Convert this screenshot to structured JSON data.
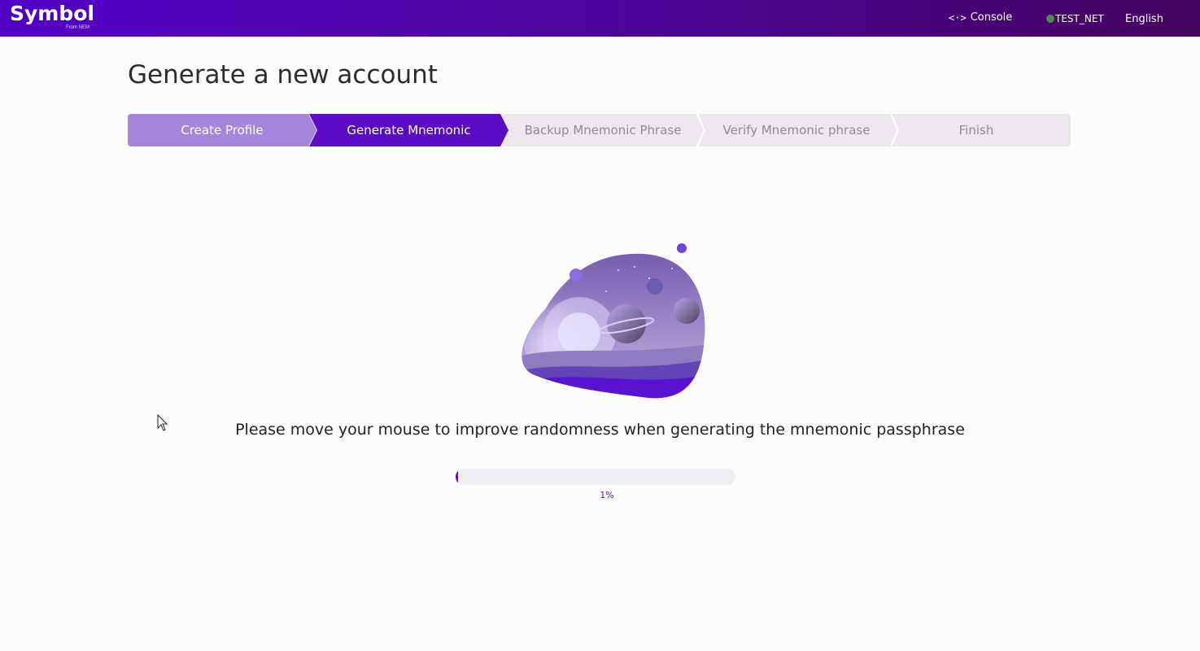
{
  "header": {
    "logo_text": "Symbol",
    "logo_sub": "From NEM",
    "console_label": "Console",
    "console_icon": "code-brackets-icon",
    "network_label": "TEST_NET",
    "network_status_color": "#4f8a4e",
    "language_label": "English"
  },
  "page": {
    "title": "Generate a new account"
  },
  "steps": [
    {
      "label": "Create Profile",
      "state": "done"
    },
    {
      "label": "Generate Mnemonic",
      "state": "active"
    },
    {
      "label": "Backup Mnemonic Phrase",
      "state": "todo"
    },
    {
      "label": "Verify Mnemonic phrase",
      "state": "todo"
    },
    {
      "label": "Finish",
      "state": "todo"
    }
  ],
  "main": {
    "illustration": "space-planets-illustration",
    "hint": "Please move your mouse to improve randomness when generating the mnemonic passphrase",
    "progress_percent": 1,
    "progress_label": "1%"
  },
  "colors": {
    "brand": "#5a0cc5",
    "step_done": "#a685dd",
    "step_todo_bg": "#ede8ee"
  }
}
